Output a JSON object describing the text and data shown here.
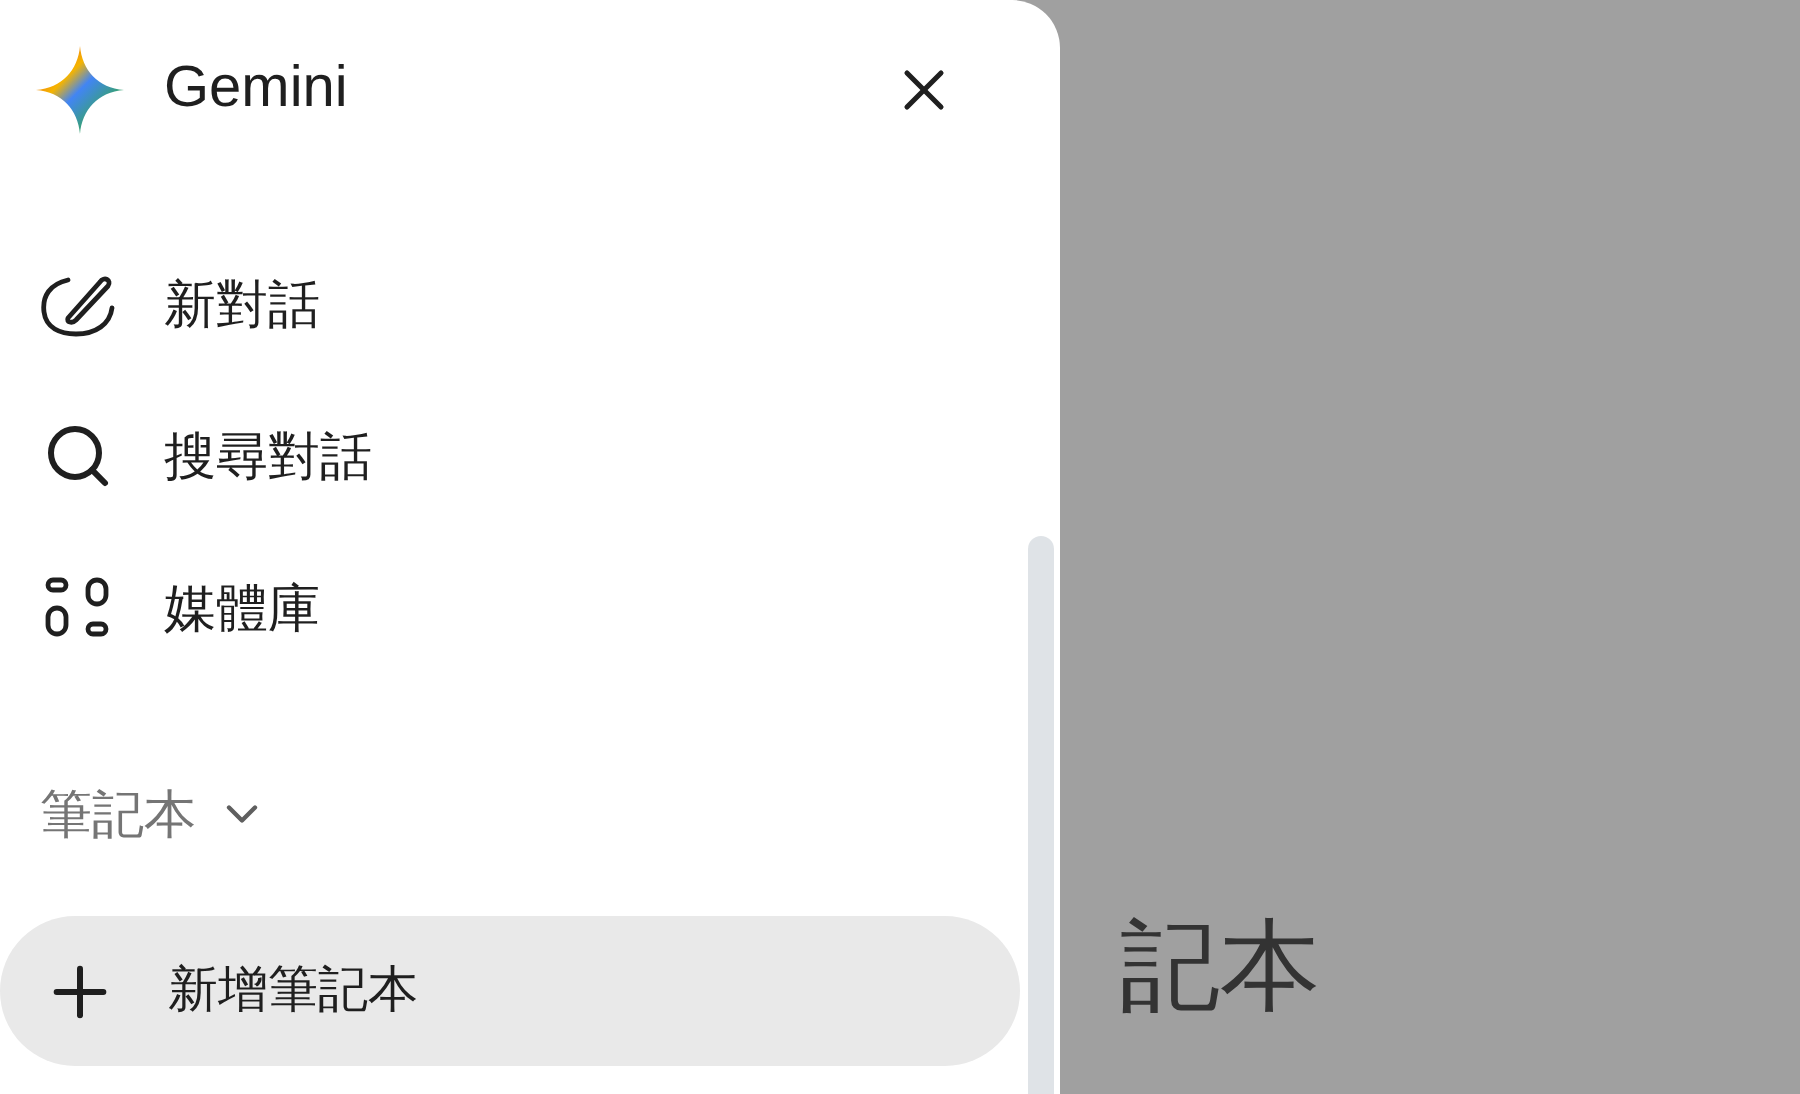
{
  "drawer": {
    "title": "Gemini",
    "nav_items": [
      {
        "kind": "new-chat",
        "label": "新對話"
      },
      {
        "kind": "search",
        "label": "搜尋對話"
      },
      {
        "kind": "library",
        "label": "媒體庫"
      }
    ],
    "section": {
      "title": "筆記本",
      "expanded": true
    },
    "new_notebook_button": "新增筆記本"
  },
  "background": {
    "heading": "記本"
  }
}
